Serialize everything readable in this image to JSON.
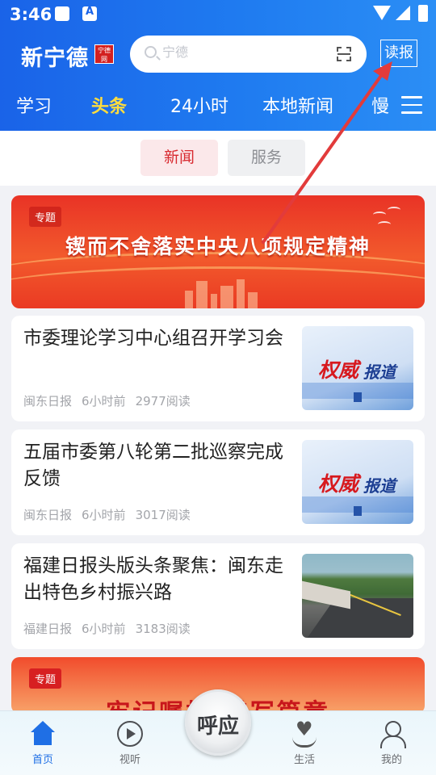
{
  "status": {
    "time": "3:46",
    "icons": [
      "image-icon",
      "a-badge-icon",
      "wifi-icon",
      "signal-icon",
      "battery-icon"
    ]
  },
  "header": {
    "logo": "新宁德",
    "logo_seal": "宁德 网",
    "search": {
      "placeholder": "宁德",
      "icon": "search-icon",
      "scan_icon": "scan-icon"
    },
    "read_button": "读报",
    "nav": [
      {
        "label": "学习",
        "active": false
      },
      {
        "label": "头条",
        "active": true
      },
      {
        "label": "24小时",
        "active": false
      },
      {
        "label": "本地新闻",
        "active": false
      },
      {
        "label": "慢",
        "active": false
      }
    ],
    "menu_icon": "hamburger-menu-icon",
    "colors": {
      "bar": "#1f74ee",
      "active_tab": "#ffdd3d"
    }
  },
  "segment": {
    "active": "新闻",
    "inactive": "服务",
    "colors": {
      "active_text": "#d82a30",
      "active_bg": "#fbe8ea"
    }
  },
  "banners": [
    {
      "tag": "专题",
      "title": "锲而不舍落实中央八项规定精神"
    },
    {
      "tag": "专题",
      "title": "牢记嘱托 谱写篇章"
    }
  ],
  "news": [
    {
      "title": "市委理论学习中心组召开学习会",
      "source": "闽东日报",
      "time": "6小时前",
      "reads": "2977阅读",
      "thumb": {
        "type": "authority",
        "text_red": "权威",
        "text_blue": "报道"
      }
    },
    {
      "title": "五届市委第八轮第二批巡察完成反馈",
      "source": "闽东日报",
      "time": "6小时前",
      "reads": "3017阅读",
      "thumb": {
        "type": "authority",
        "text_red": "权威",
        "text_blue": "报道"
      }
    },
    {
      "title": "福建日报头版头条聚焦：闽东走出特色乡村振兴路",
      "source": "福建日报",
      "time": "6小时前",
      "reads": "3183阅读",
      "thumb": {
        "type": "photo",
        "icon": "village-road-photo"
      }
    }
  ],
  "tabbar": {
    "items": [
      {
        "label": "首页",
        "icon": "home-icon",
        "active": true
      },
      {
        "label": "视听",
        "icon": "play-circle-icon",
        "active": false
      },
      {
        "label": "生活",
        "icon": "heart-hand-icon",
        "active": false
      },
      {
        "label": "我的",
        "icon": "user-icon",
        "active": false
      }
    ],
    "center": {
      "label": "呼应",
      "icon": "center-action-icon"
    },
    "colors": {
      "active": "#1f6fe5"
    }
  },
  "annotation": {
    "color": "#e23b3b"
  }
}
